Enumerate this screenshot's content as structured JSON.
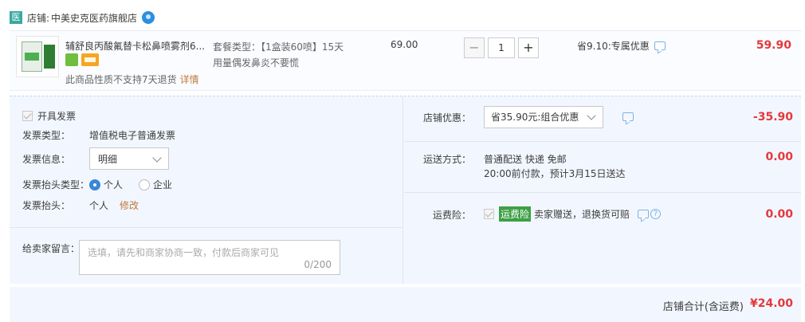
{
  "store": {
    "icon_text": "医",
    "label": "店铺:",
    "name": "中美史克医药旗舰店"
  },
  "item": {
    "title": "辅舒良丙酸氟替卡松鼻喷雾剂6...",
    "sku_line1": "套餐类型：【1盒装60喷】15天",
    "sku_line2": "用量偶发鼻炎不要慌",
    "return_note": "此商品性质不支持7天退货",
    "return_link": "详情",
    "unit_price": "69.00",
    "quantity": "1",
    "minus": "−",
    "plus": "+",
    "saving": "省9.10:专属优惠",
    "total": "59.90"
  },
  "invoice": {
    "enable_label": "开具发票",
    "type_label": "发票类型：",
    "type_value": "增值税电子普通发票",
    "info_label": "发票信息：",
    "info_value": "明细",
    "header_type_label": "发票抬头类型：",
    "header_type_options": [
      "个人",
      "企业"
    ],
    "header_label": "发票抬头：",
    "header_value": "个人",
    "edit_link": "修改"
  },
  "memo": {
    "label": "给卖家留言：",
    "placeholder": "选填，请先和商家协商一致，付款后商家可见",
    "count": "0/200"
  },
  "discount": {
    "label": "店铺优惠：",
    "value": "省35.90元:组合优惠",
    "amount": "-35.90"
  },
  "shipping": {
    "label": "运送方式：",
    "line1": "普通配送 快递 免邮",
    "line2": "20:00前付款，预计3月15日送达",
    "amount": "0.00"
  },
  "insurance": {
    "label": "运费险：",
    "tag": "运费险",
    "text": "卖家赠送，退换货可赔",
    "help": "?",
    "amount": "0.00"
  },
  "footer": {
    "label": "店铺合计(含运费)",
    "amount": "¥24.00"
  },
  "colors": {
    "price_red": "#e4393c",
    "link_orange": "#c0783c",
    "panel_bg": "#f2f7ff",
    "accent_blue": "#3a86d8",
    "insurance_green": "#3da046"
  }
}
